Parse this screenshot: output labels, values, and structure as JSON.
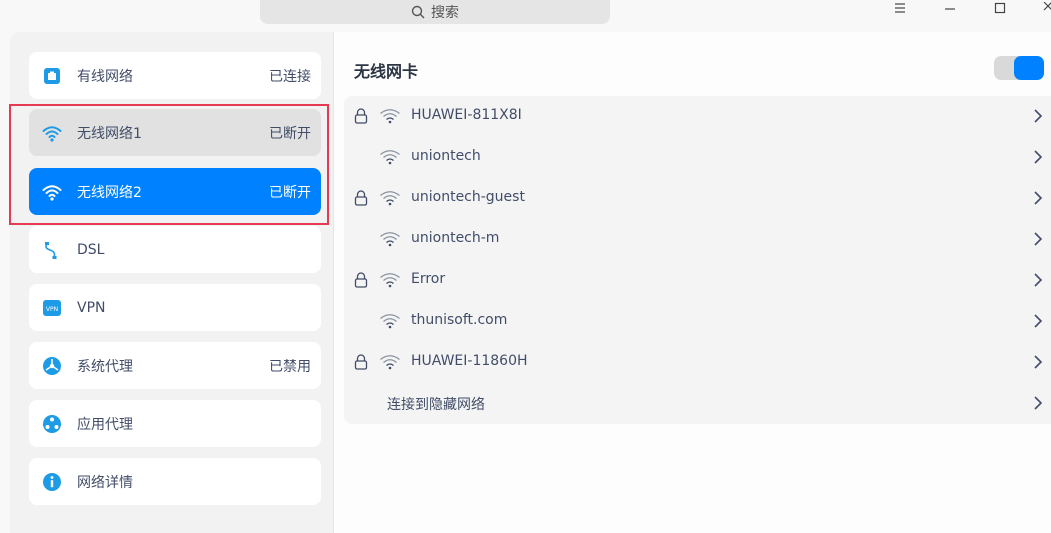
{
  "titlebar": {
    "search_placeholder": "搜索",
    "menu_icon": "hamburger-icon",
    "minimize_icon": "minimize-icon",
    "maximize_icon": "maximize-icon",
    "close_icon": "close-icon"
  },
  "sidebar": {
    "items": [
      {
        "label": "有线网络",
        "status": "已连接",
        "icon": "wired-network-icon"
      },
      {
        "label": "无线网络1",
        "status": "已断开",
        "icon": "wifi-icon"
      },
      {
        "label": "无线网络2",
        "status": "已断开",
        "icon": "wifi-icon"
      },
      {
        "label": "DSL",
        "status": "",
        "icon": "dsl-icon"
      },
      {
        "label": "VPN",
        "status": "",
        "icon": "vpn-icon"
      },
      {
        "label": "系统代理",
        "status": "已禁用",
        "icon": "system-proxy-icon"
      },
      {
        "label": "应用代理",
        "status": "",
        "icon": "app-proxy-icon"
      },
      {
        "label": "网络详情",
        "status": "",
        "icon": "info-icon"
      }
    ]
  },
  "content": {
    "title": "无线网卡",
    "enabled": true,
    "accent_color": "#0081ff",
    "networks": [
      {
        "name": "HUAWEI-811X8I",
        "locked": true
      },
      {
        "name": "uniontech",
        "locked": false
      },
      {
        "name": "uniontech-guest",
        "locked": true
      },
      {
        "name": "uniontech-m",
        "locked": false
      },
      {
        "name": "Error",
        "locked": true
      },
      {
        "name": "thunisoft.com",
        "locked": false
      },
      {
        "name": "HUAWEI-11860H",
        "locked": true
      }
    ],
    "hidden_network_label": "连接到隐藏网络"
  }
}
